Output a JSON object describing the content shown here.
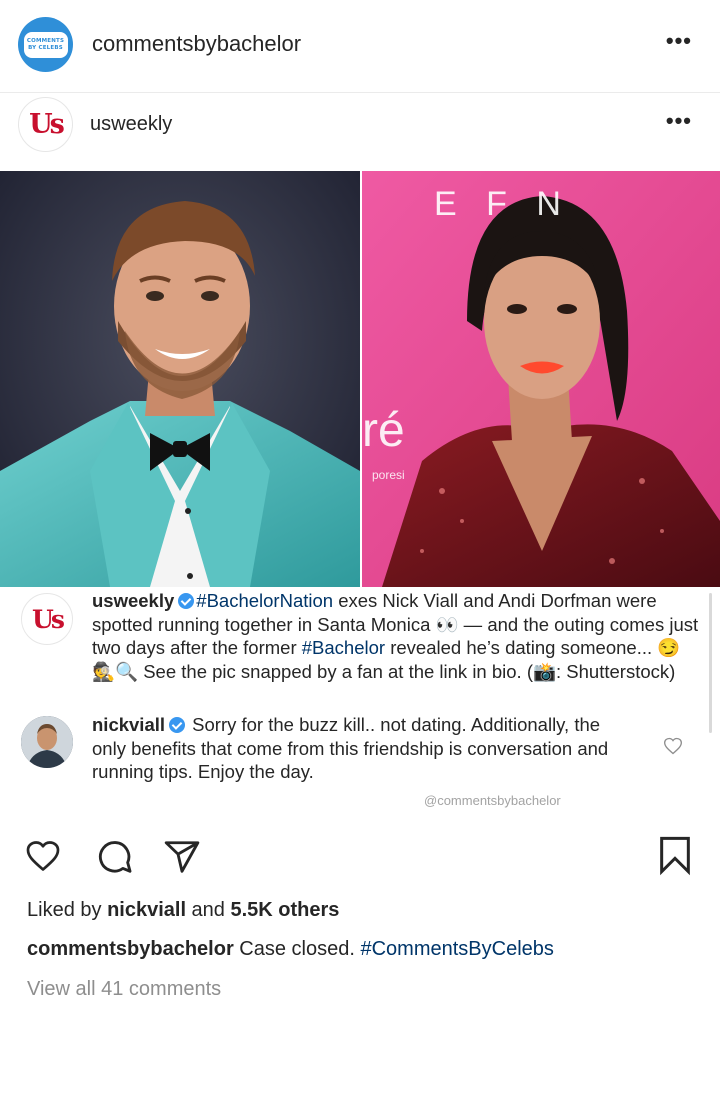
{
  "header": {
    "account_name": "commentsbybachelor",
    "avatar_text": [
      "COMMENTS",
      "BY CELEBS"
    ],
    "more": "•••"
  },
  "post": {
    "account_name": "usweekly",
    "logo_text": "Us",
    "more": "•••"
  },
  "photos": {
    "left_alt": "man in teal velvet tuxedo",
    "right_sign_top": "E F   N",
    "right_sign_logo": "ré",
    "right_sign_small": "poresi"
  },
  "caption": {
    "user": "usweekly",
    "hashtag1": "#BachelorNation",
    "text1": " exes Nick Viall and Andi Dorfman were spotted running together in Santa Monica 👀 — and the outing comes just two days after the former ",
    "hashtag2": "#Bachelor",
    "text2": " revealed he’s dating someone... 😏🕵🔍 See the pic snapped by a fan at the link in bio. (📸: Shutterstock)"
  },
  "reply": {
    "user": "nickviall",
    "text": " Sorry for the buzz kill.. not dating. Additionally, the only benefits that come from this friendship is conversation and running tips.  Enjoy the day."
  },
  "watermark": "@commentsbybachelor",
  "likes": {
    "prefix": "Liked by ",
    "user": "nickviall",
    "middle": " and ",
    "others": "5.5K others"
  },
  "comment": {
    "user": "commentsbybachelor",
    "text": " Case closed. ",
    "hashtag": "#CommentsByCelebs"
  },
  "view_all": "View all 41 comments",
  "colors": {
    "blue_avatar": "#2f8fd8",
    "us_red": "#c8102e",
    "hashtag": "#003569",
    "verified": "#3897f0",
    "pink_bg": "#e9428f",
    "teal_suit": "#4cb7b8"
  },
  "icons": [
    "heart-icon",
    "comment-icon",
    "share-icon",
    "bookmark-icon",
    "verified-icon",
    "more-icon"
  ]
}
